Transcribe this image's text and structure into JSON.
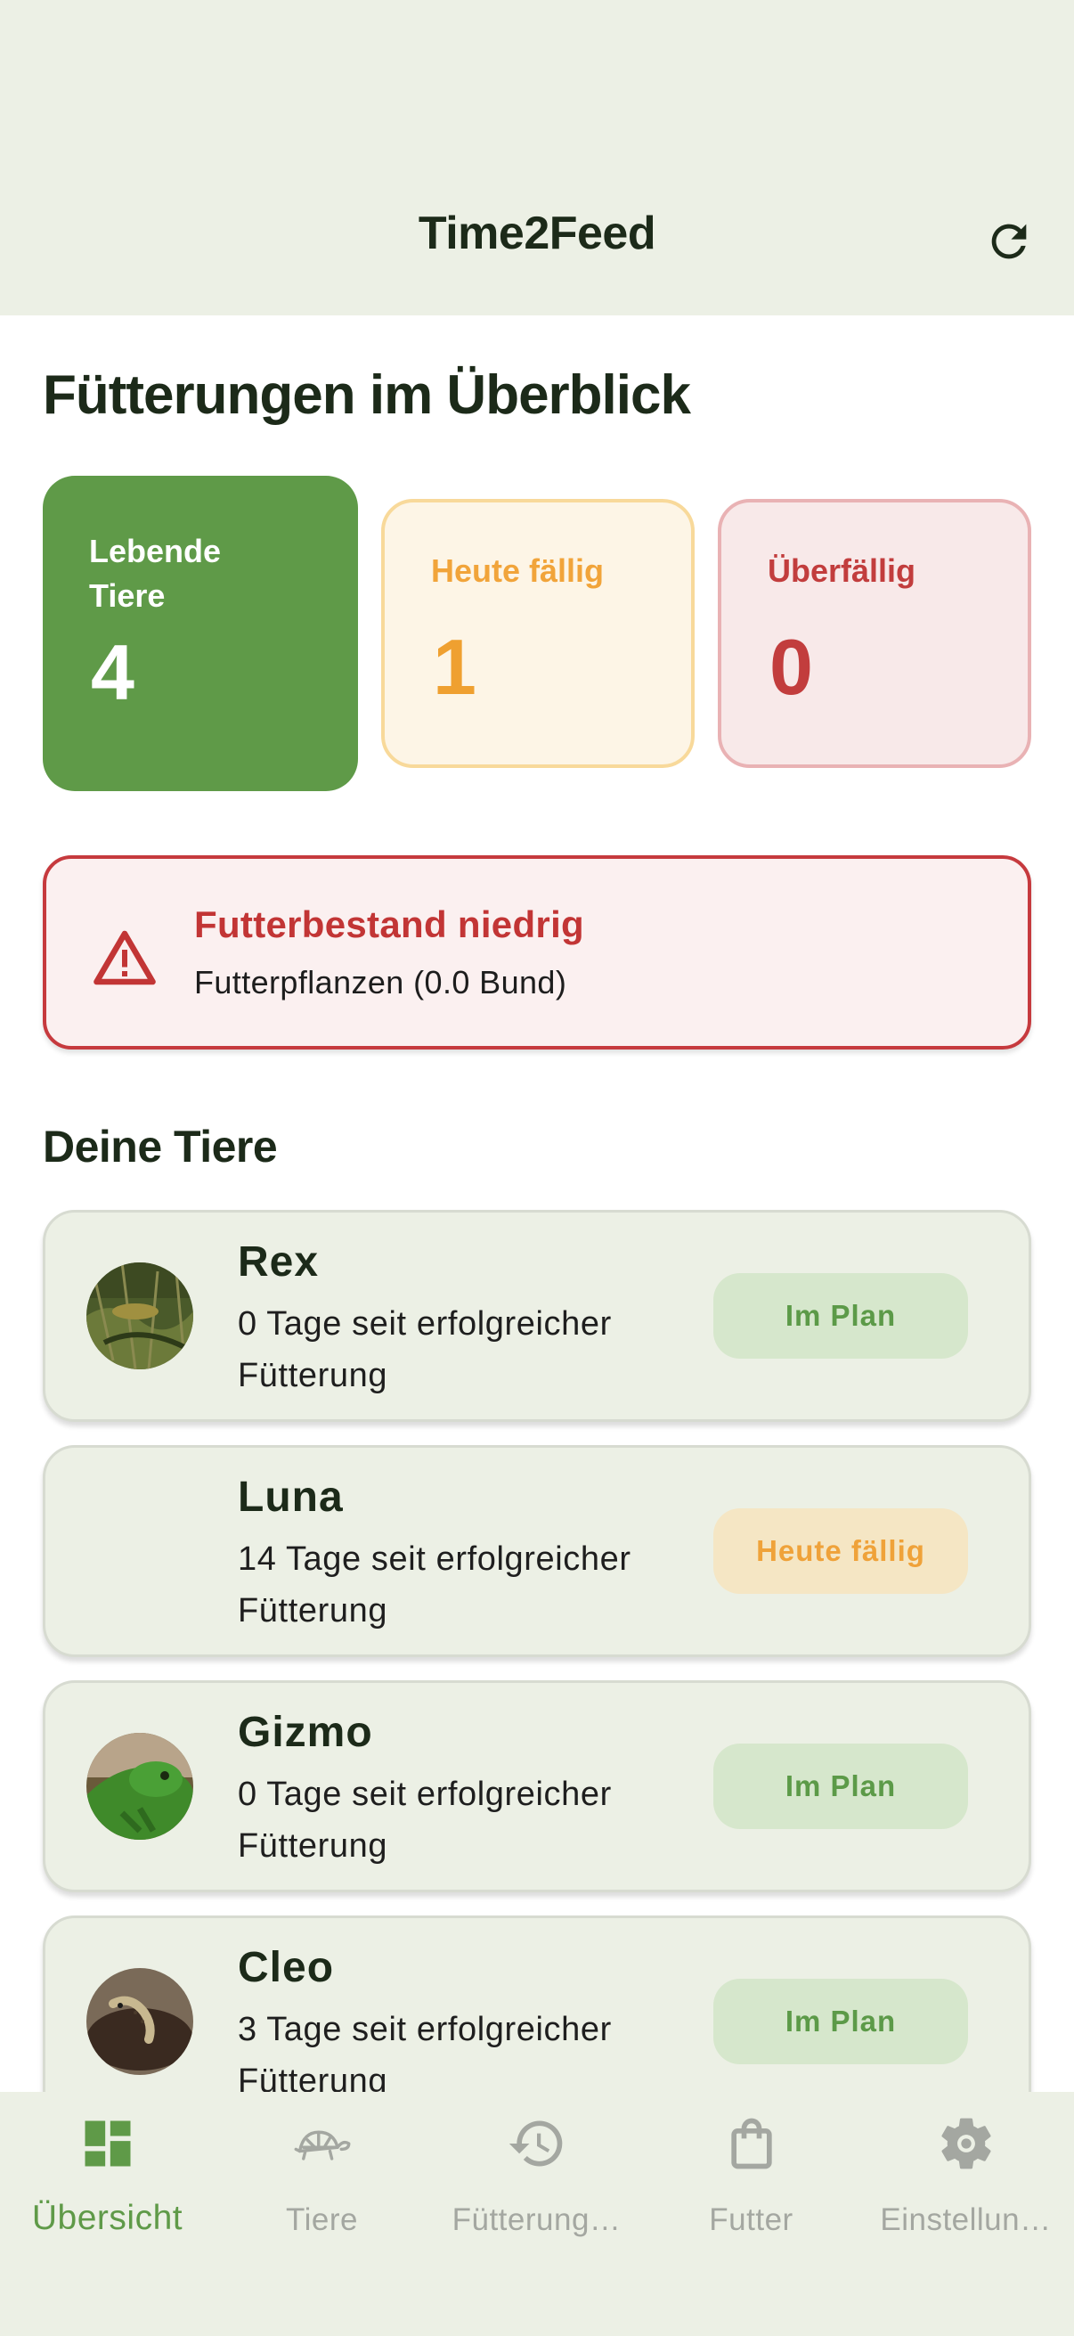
{
  "header": {
    "title": "Time2Feed"
  },
  "overview": {
    "title": "Fütterungen im Überblick",
    "cards": {
      "alive": {
        "label": "Lebende Tiere",
        "value": "4"
      },
      "due_today": {
        "label": "Heute fällig",
        "value": "1"
      },
      "overdue": {
        "label": "Überfällig",
        "value": "0"
      }
    }
  },
  "alert": {
    "title": "Futterbestand niedrig",
    "text": "Futterpflanzen (0.0 Bund)"
  },
  "animals": {
    "title": "Deine Tiere",
    "items": [
      {
        "name": "Rex",
        "info": "0 Tage seit erfolgreicher Fütterung",
        "status": "Im Plan"
      },
      {
        "name": "Luna",
        "info": "14 Tage seit erfolgreicher Fütterung",
        "status": "Heute fällig"
      },
      {
        "name": "Gizmo",
        "info": "0 Tage seit erfolgreicher Fütterung",
        "status": "Im Plan"
      },
      {
        "name": "Cleo",
        "info": "3 Tage seit erfolgreicher Fütterung",
        "status": "Im Plan"
      }
    ]
  },
  "nav": {
    "items": [
      {
        "label": "Übersicht",
        "icon": "dashboard-icon"
      },
      {
        "label": "Tiere",
        "icon": "turtle-icon"
      },
      {
        "label": "Fütterung…",
        "icon": "history-icon"
      },
      {
        "label": "Futter",
        "icon": "shopping-bag-icon"
      },
      {
        "label": "Einstellun…",
        "icon": "gear-icon"
      }
    ]
  },
  "colors": {
    "primary": "#5f9a48",
    "warning": "#efa030",
    "danger": "#c23d3d",
    "surface": "#ecf0e5"
  }
}
